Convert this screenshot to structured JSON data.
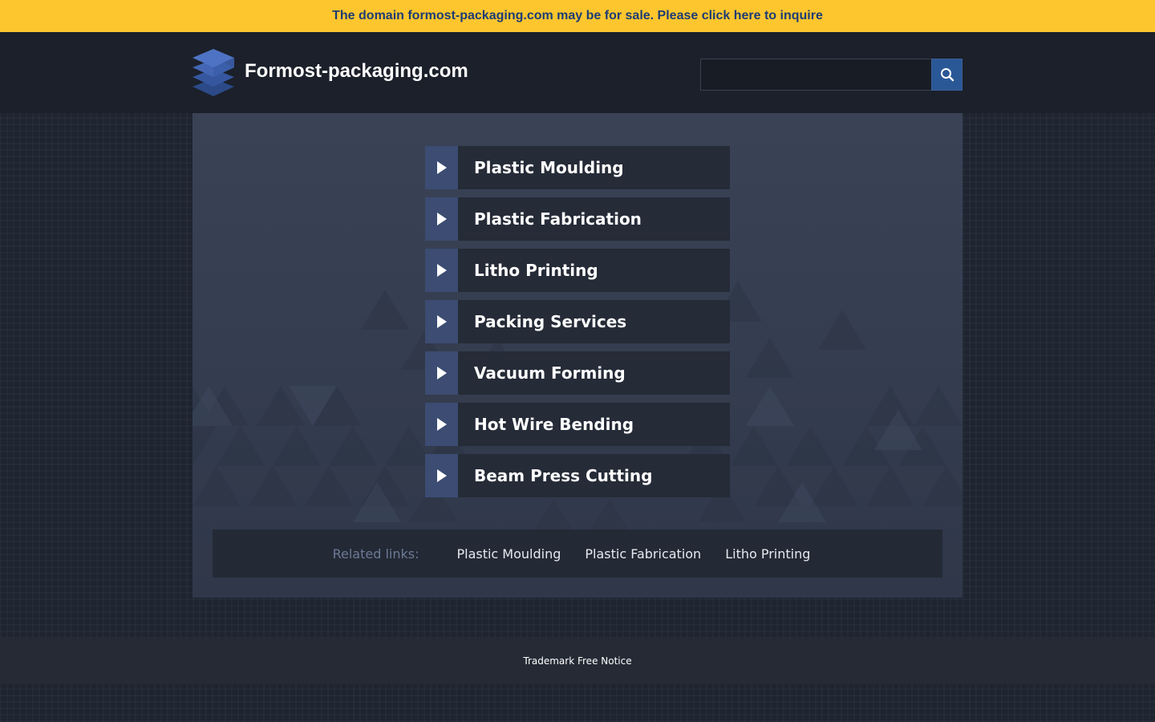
{
  "banner": {
    "text": "The domain formost-packaging.com may be for sale. Please click here to inquire",
    "background": "#fec62e",
    "text_color": "#1d3c73"
  },
  "header": {
    "site_name": "Formost-packaging.com",
    "logo_icon": "stacked-layers-icon",
    "search": {
      "placeholder": "",
      "value": "",
      "button_icon": "search-icon"
    }
  },
  "links": [
    {
      "label": "Plastic Moulding",
      "icon": "play-triangle-icon"
    },
    {
      "label": "Plastic Fabrication",
      "icon": "play-triangle-icon"
    },
    {
      "label": "Litho Printing",
      "icon": "play-triangle-icon"
    },
    {
      "label": "Packing Services",
      "icon": "play-triangle-icon"
    },
    {
      "label": "Vacuum Forming",
      "icon": "play-triangle-icon"
    },
    {
      "label": "Hot Wire Bending",
      "icon": "play-triangle-icon"
    },
    {
      "label": "Beam Press Cutting",
      "icon": "play-triangle-icon"
    }
  ],
  "related": {
    "label": "Related links:",
    "items": [
      "Plastic Moulding",
      "Plastic Fabrication",
      "Litho Printing"
    ]
  },
  "footer": {
    "text": "Trademark Free Notice"
  },
  "colors": {
    "page_background": "#1e2430",
    "header_background": "#1b202a",
    "panel_background": "#3a4356",
    "link_label_background": "#252b37",
    "link_arrow_background": "#3c4c72",
    "search_button": "#2a5796",
    "related_label": "#6b7a96"
  }
}
